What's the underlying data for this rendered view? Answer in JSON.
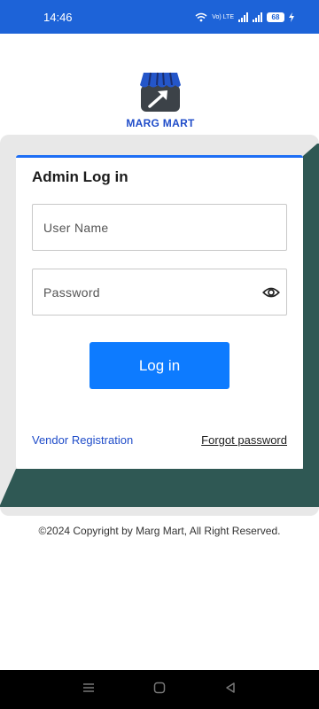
{
  "status_bar": {
    "time": "14:46",
    "network_label": "Vo) LTE",
    "battery": "68"
  },
  "logo": {
    "icon": "storefront-arrow-icon",
    "text": "MARG MART",
    "colors": {
      "awning": "#2456c9",
      "body": "#3c4248",
      "arrow": "#ffffff"
    }
  },
  "login_card": {
    "title": "Admin Log in",
    "username_placeholder": "User Name",
    "password_placeholder": "Password",
    "login_label": "Log in",
    "vendor_link": "Vendor Registration",
    "forgot_link": "Forgot password"
  },
  "footer": {
    "copyright": "©2024 Copyright by Marg Mart, All Right Reserved."
  },
  "nav_bar": {
    "items": [
      "menu-icon",
      "home-icon",
      "back-icon"
    ]
  },
  "colors": {
    "status_bar": "#1d63d8",
    "accent": "#0d7bff",
    "card_border": "#1d6ef5",
    "panel_teal": "#2f5854",
    "panel_grey": "#e8e8e8",
    "link": "#1f4cc9"
  }
}
